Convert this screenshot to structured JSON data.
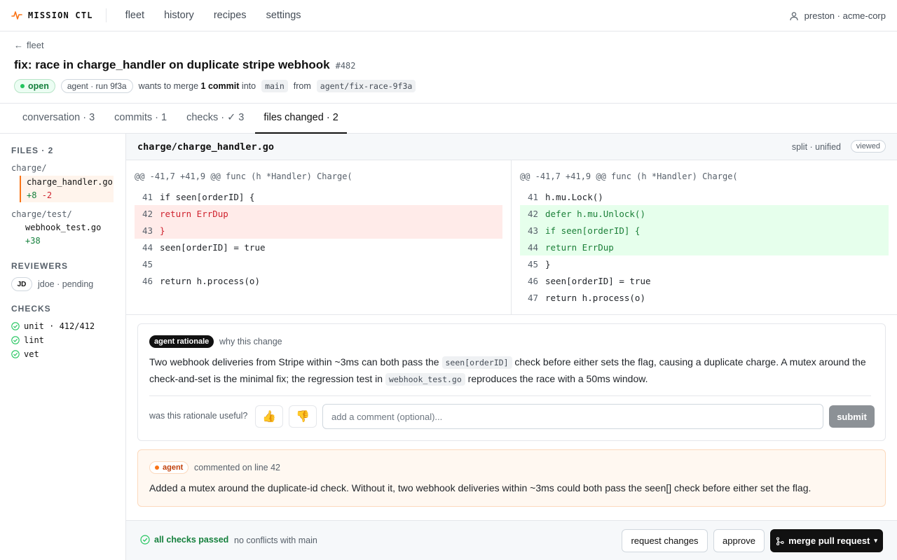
{
  "app": {
    "name": "MISSION CTL",
    "nav": [
      "fleet",
      "history",
      "recipes",
      "settings"
    ],
    "user": "preston · acme-corp"
  },
  "pr": {
    "back": "fleet",
    "title": "fix: race in charge_handler on duplicate stripe webhook",
    "number": "#482",
    "status": "open",
    "run": "agent · run 9f3a",
    "meta_prefix": "wants to merge",
    "commit_count": "1 commit",
    "meta_into": "into",
    "base": "main",
    "meta_from": "from",
    "head": "agent/fix-race-9f3a"
  },
  "tabs": [
    "conversation · 3",
    "commits · 1",
    "checks · ✓ 3",
    "files changed · 2"
  ],
  "sidebar": {
    "files_heading": "FILES · 2",
    "dirs": [
      {
        "dir": "charge/",
        "file": "charge_handler.go",
        "stat_add": "+8",
        "stat_del": "-2"
      },
      {
        "dir": "charge/test/",
        "file": "webhook_test.go",
        "stat_add": "+38"
      }
    ],
    "reviewers_heading": "REVIEWERS",
    "reviewer_initials": "JD",
    "reviewer_text": "jdoe · pending",
    "checks_heading": "CHECKS",
    "checks": [
      "unit · 412/412",
      "lint",
      "vet"
    ]
  },
  "diff": {
    "file_path": "charge/charge_handler.go",
    "view_mode": "split · unified",
    "viewed": "viewed",
    "hunk": "@@ -41,7 +41,9 @@ func (h *Handler) Charge(",
    "left": [
      {
        "n": "41",
        "code": "if seen[orderID] {",
        "kind": "ctx"
      },
      {
        "n": "42",
        "code": "return ErrDup",
        "kind": "rem"
      },
      {
        "n": "43",
        "code": "}",
        "kind": "rem"
      },
      {
        "n": "44",
        "code": "seen[orderID] = true",
        "kind": "ctx"
      },
      {
        "n": "45",
        "code": "",
        "kind": "ctx"
      },
      {
        "n": "46",
        "code": "return h.process(o)",
        "kind": "ctx"
      }
    ],
    "right": [
      {
        "n": "41",
        "code": "h.mu.Lock()",
        "kind": "ctx"
      },
      {
        "n": "42",
        "code": "defer h.mu.Unlock()",
        "kind": "add"
      },
      {
        "n": "43",
        "code": "if seen[orderID] {",
        "kind": "add"
      },
      {
        "n": "44",
        "code": "return ErrDup",
        "kind": "add"
      },
      {
        "n": "45",
        "code": "}",
        "kind": "ctx"
      },
      {
        "n": "46",
        "code": "seen[orderID] = true",
        "kind": "ctx"
      },
      {
        "n": "47",
        "code": "return h.process(o)",
        "kind": "ctx"
      }
    ]
  },
  "rationale": {
    "tag": "agent rationale",
    "subtitle": "why this change",
    "text_1": "Two webhook deliveries from Stripe within ~3ms can both pass the",
    "code_1": "seen[orderID]",
    "text_2": "check before either sets the flag, causing a duplicate charge. A mutex around the check-and-set is the minimal fix; the regression test in",
    "code_2": "webhook_test.go",
    "text_3": "reproduces the race with a 50ms window.",
    "useful_label": "was this rationale useful?",
    "thumb_up": "👍",
    "thumb_down": "👎",
    "comment_placeholder": "add a comment (optional)...",
    "submit": "submit"
  },
  "agent_comment": {
    "tag": "agent",
    "location": "commented on line 42",
    "text": "Added a mutex around the duplicate-id check. Without it, two webhook deliveries within ~3ms could both pass the seen[] check before either set the flag."
  },
  "footer": {
    "checks_status": "all checks passed",
    "conflicts": "no conflicts with main",
    "request_changes": "request changes",
    "approve": "approve",
    "merge": "merge pull request"
  },
  "colors": {
    "brand": "#f97316",
    "success": "#15803d",
    "danger": "#cf222e",
    "primary_button": "#111111"
  }
}
